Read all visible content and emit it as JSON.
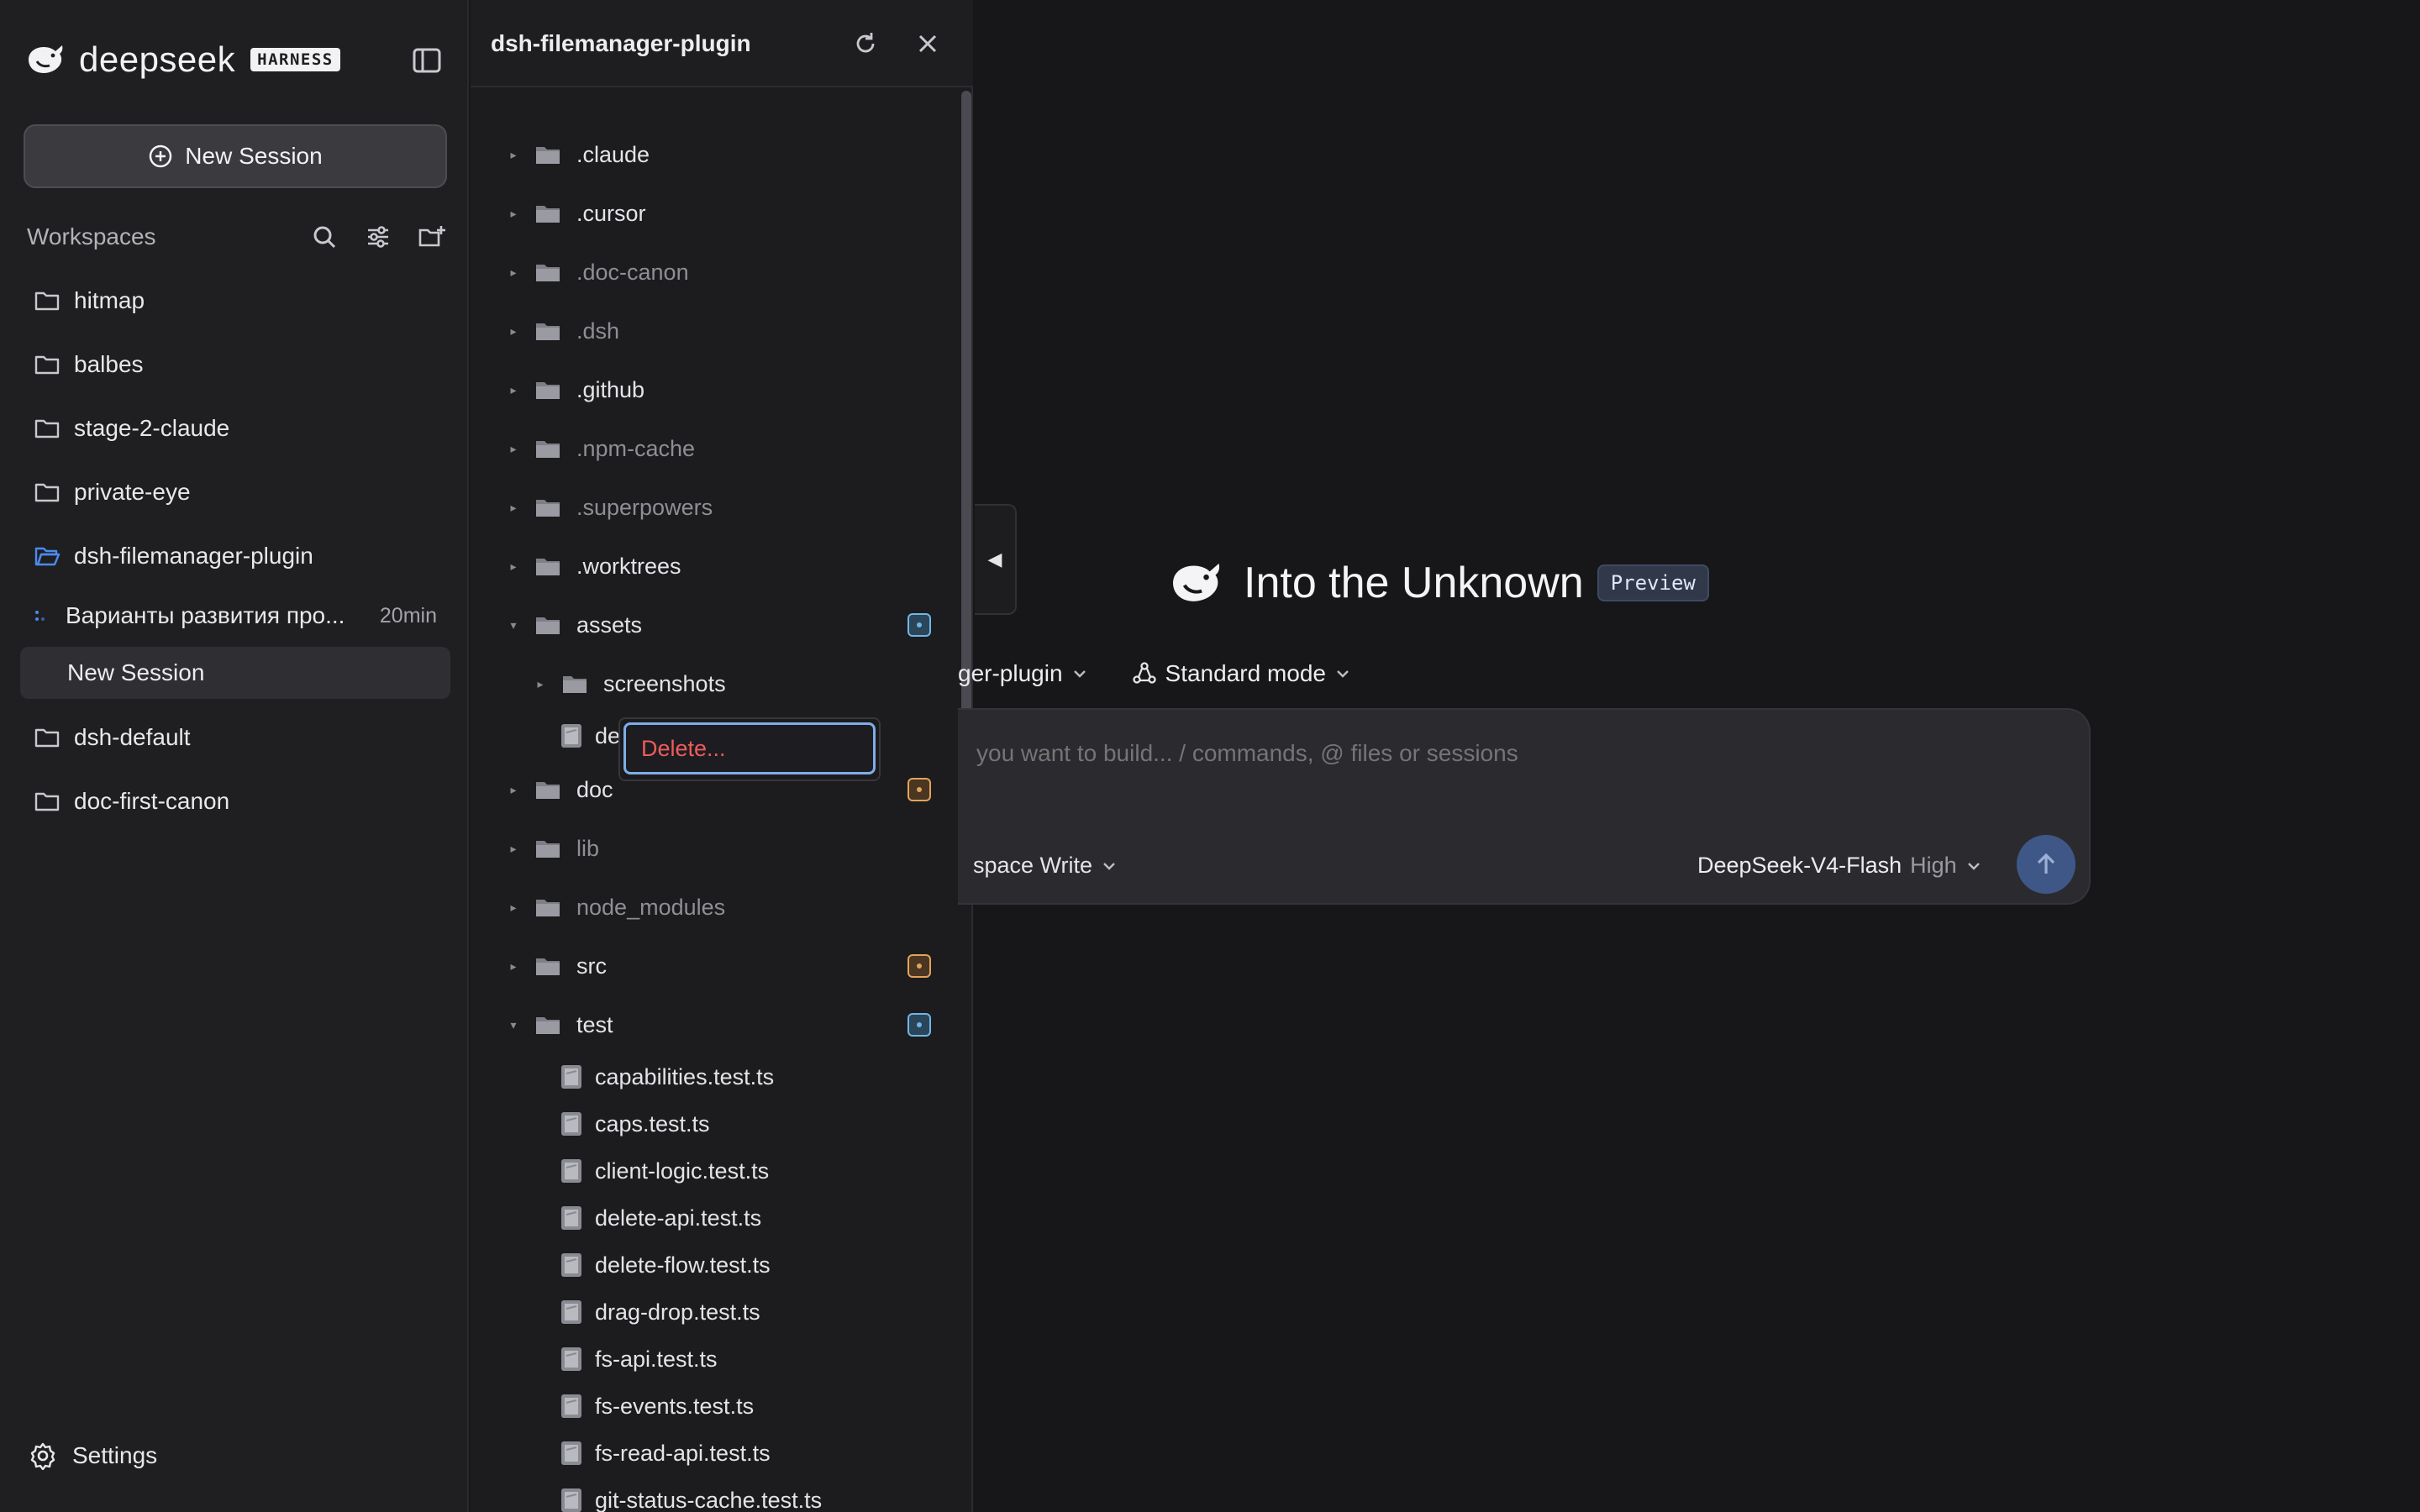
{
  "brand": {
    "name": "deepseek",
    "badge": "HARNESS"
  },
  "sidebar": {
    "new_session_label": "New Session",
    "workspaces_title": "Workspaces",
    "workspaces_before": [
      {
        "label": "hitmap"
      },
      {
        "label": "balbes"
      },
      {
        "label": "stage-2-claude"
      },
      {
        "label": "private-eye"
      },
      {
        "label": "dsh-filemanager-plugin",
        "open": true
      }
    ],
    "session": {
      "title": "Варианты развития про...",
      "time": "20min"
    },
    "current_session": "New Session",
    "workspaces_after": [
      {
        "label": "dsh-default"
      },
      {
        "label": "doc-first-canon"
      }
    ],
    "settings_label": "Settings"
  },
  "file_manager": {
    "title": "dsh-filemanager-plugin",
    "tree": [
      {
        "label": ".claude",
        "kind": "folder",
        "depth": 0,
        "caret": "▸",
        "dim": false
      },
      {
        "label": ".cursor",
        "kind": "folder",
        "depth": 0,
        "caret": "▸",
        "dim": false
      },
      {
        "label": ".doc-canon",
        "kind": "folder",
        "depth": 0,
        "caret": "▸",
        "dim": true
      },
      {
        "label": ".dsh",
        "kind": "folder",
        "depth": 0,
        "caret": "▸",
        "dim": true
      },
      {
        "label": ".github",
        "kind": "folder",
        "depth": 0,
        "caret": "▸",
        "dim": false
      },
      {
        "label": ".npm-cache",
        "kind": "folder",
        "depth": 0,
        "caret": "▸",
        "dim": true
      },
      {
        "label": ".superpowers",
        "kind": "folder",
        "depth": 0,
        "caret": "▸",
        "dim": true
      },
      {
        "label": ".worktrees",
        "kind": "folder",
        "depth": 0,
        "caret": "▸",
        "dim": false
      },
      {
        "label": "assets",
        "kind": "folder",
        "depth": 0,
        "caret": "▾",
        "dim": false,
        "status": "blue"
      },
      {
        "label": "screenshots",
        "kind": "folder",
        "depth": 1,
        "caret": "▸",
        "dim": false
      },
      {
        "label": "demo_preview.png",
        "kind": "file",
        "depth": 1,
        "dim": false
      },
      {
        "label": "doc",
        "kind": "folder",
        "depth": 0,
        "caret": "▸",
        "dim": false,
        "status": "orange"
      },
      {
        "label": "lib",
        "kind": "folder",
        "depth": 0,
        "caret": "▸",
        "dim": true
      },
      {
        "label": "node_modules",
        "kind": "folder",
        "depth": 0,
        "caret": "▸",
        "dim": true
      },
      {
        "label": "src",
        "kind": "folder",
        "depth": 0,
        "caret": "▸",
        "dim": false,
        "status": "orange"
      },
      {
        "label": "test",
        "kind": "folder",
        "depth": 0,
        "caret": "▾",
        "dim": false,
        "status": "blue"
      },
      {
        "label": "capabilities.test.ts",
        "kind": "file",
        "depth": 1,
        "dim": false
      },
      {
        "label": "caps.test.ts",
        "kind": "file",
        "depth": 1,
        "dim": false
      },
      {
        "label": "client-logic.test.ts",
        "kind": "file",
        "depth": 1,
        "dim": false
      },
      {
        "label": "delete-api.test.ts",
        "kind": "file",
        "depth": 1,
        "dim": false
      },
      {
        "label": "delete-flow.test.ts",
        "kind": "file",
        "depth": 1,
        "dim": false
      },
      {
        "label": "drag-drop.test.ts",
        "kind": "file",
        "depth": 1,
        "dim": false
      },
      {
        "label": "fs-api.test.ts",
        "kind": "file",
        "depth": 1,
        "dim": false
      },
      {
        "label": "fs-events.test.ts",
        "kind": "file",
        "depth": 1,
        "dim": false
      },
      {
        "label": "fs-read-api.test.ts",
        "kind": "file",
        "depth": 1,
        "dim": false
      },
      {
        "label": "git-status-cache.test.ts",
        "kind": "file",
        "depth": 1,
        "dim": false
      }
    ],
    "context_menu": {
      "delete_label": "Delete..."
    }
  },
  "main": {
    "panel_toggle": "◀",
    "hero_title": "Into the Unknown",
    "hero_badge": "Preview",
    "workspace_selector": "ger-plugin",
    "mode_selector": "Standard mode",
    "composer_placeholder": "you want to build... / commands, @ files or sessions",
    "permission_label": "space Write",
    "model_name": "DeepSeek-V4-Flash",
    "model_effort": "High"
  },
  "colors": {
    "accent_blue": "#4b8bf0",
    "danger_red": "#ef5b5b",
    "status_blue": "#6fb6e8",
    "status_orange": "#e2a45a",
    "send_button": "#3f5787"
  }
}
